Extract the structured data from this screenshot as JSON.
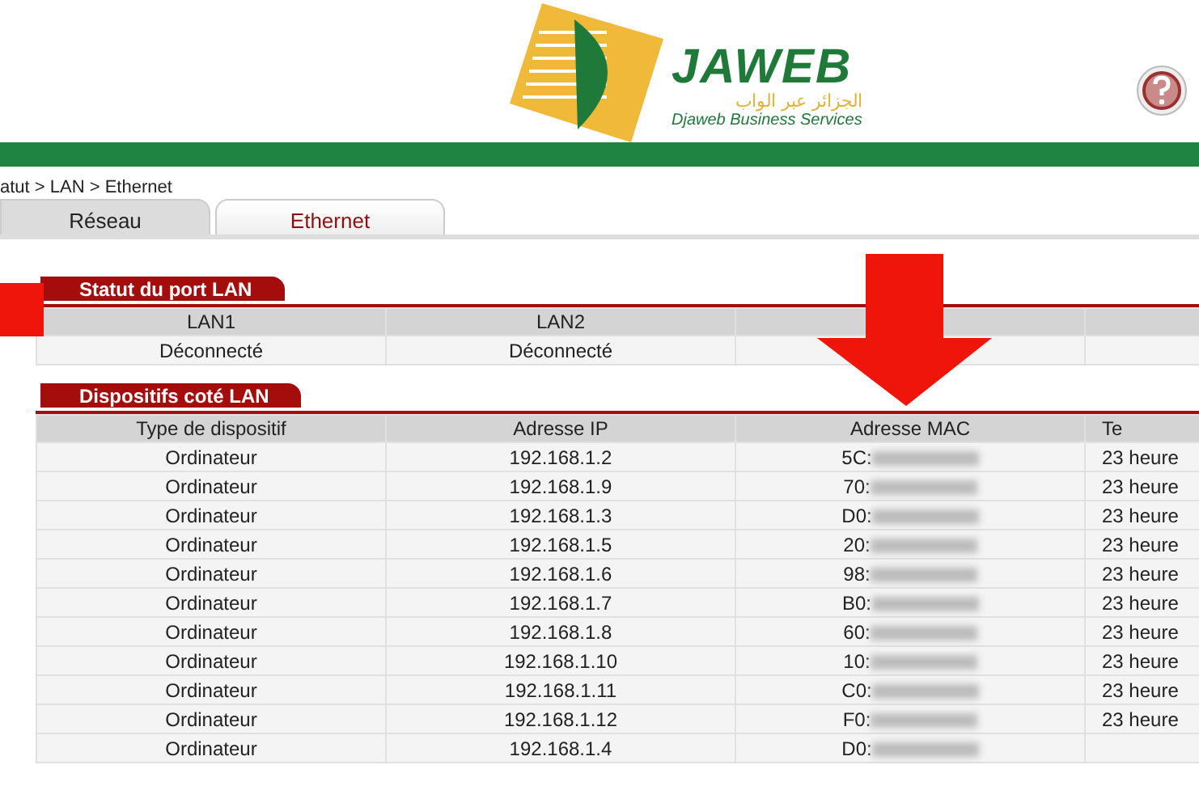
{
  "logo": {
    "name": "JAWEB",
    "arabic": "الجزائر عبر الواب",
    "tagline": "Djaweb Business Services"
  },
  "breadcrumb": "atut > LAN > Ethernet",
  "tabs": [
    {
      "label": "Réseau",
      "selected": false
    },
    {
      "label": "Ethernet",
      "selected": true
    }
  ],
  "lan_status": {
    "title": "Statut du port LAN",
    "columns": [
      "LAN1",
      "LAN2"
    ],
    "values": [
      "Déconnecté",
      "Déconnecté"
    ]
  },
  "devices": {
    "title": "Dispositifs coté LAN",
    "columns": [
      "Type de dispositif",
      "Adresse IP",
      "Adresse MAC",
      "Te"
    ],
    "rows": [
      {
        "type": "Ordinateur",
        "ip": "192.168.1.2",
        "mac": "5C:",
        "column_4": "23 heure"
      },
      {
        "type": "Ordinateur",
        "ip": "192.168.1.9",
        "mac": "70:",
        "column_4": "23 heure"
      },
      {
        "type": "Ordinateur",
        "ip": "192.168.1.3",
        "mac": "D0:",
        "column_4": "23 heure"
      },
      {
        "type": "Ordinateur",
        "ip": "192.168.1.5",
        "mac": "20:",
        "column_4": "23 heure"
      },
      {
        "type": "Ordinateur",
        "ip": "192.168.1.6",
        "mac": "98:",
        "column_4": "23 heure"
      },
      {
        "type": "Ordinateur",
        "ip": "192.168.1.7",
        "mac": "B0:",
        "column_4": "23 heure"
      },
      {
        "type": "Ordinateur",
        "ip": "192.168.1.8",
        "mac": "60:",
        "column_4": "23 heure"
      },
      {
        "type": "Ordinateur",
        "ip": "192.168.1.10",
        "mac": "10:",
        "column_4": "23 heure"
      },
      {
        "type": "Ordinateur",
        "ip": "192.168.1.11",
        "mac": "C0:",
        "column_4": "23 heure"
      },
      {
        "type": "Ordinateur",
        "ip": "192.168.1.12",
        "mac": "F0:",
        "column_4": "23 heure"
      },
      {
        "type": "Ordinateur",
        "ip": "192.168.1.4",
        "mac": "D0:"
      }
    ]
  }
}
